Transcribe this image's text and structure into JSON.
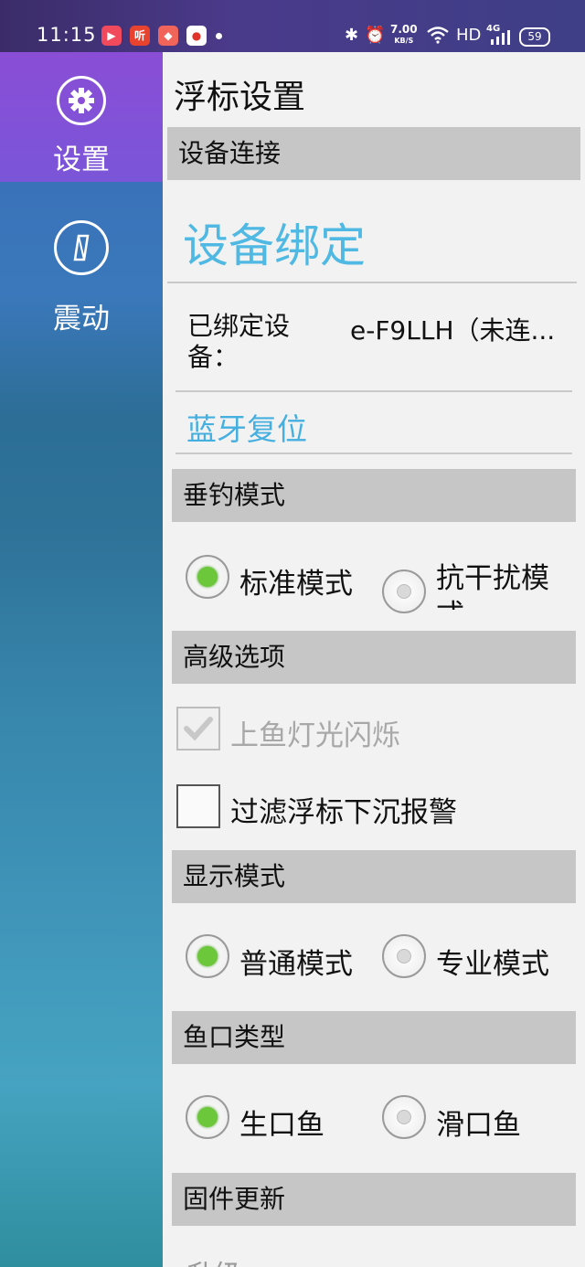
{
  "status_bar": {
    "time": "11:15",
    "net_speed": "7.00",
    "net_unit": "KB/S",
    "hd": "HD",
    "network": "4G",
    "battery": "59",
    "app_icons": [
      "video-app",
      "ting-app",
      "game-app",
      "red-app"
    ],
    "icons": [
      "bluetooth-icon",
      "alarm-icon",
      "wifi-icon",
      "signal-icon"
    ]
  },
  "sidebar": {
    "items": [
      {
        "label": "设置",
        "icon": "gear-icon",
        "active": true
      },
      {
        "label": "震动",
        "icon": "compass-icon",
        "active": false
      }
    ]
  },
  "main": {
    "title": "浮标设置",
    "device_section": {
      "header": "设备连接",
      "bind_title": "设备绑定",
      "bound_label_line1": "已绑定设",
      "bound_label_line2": "备：",
      "bound_value": "e-F9LLH（未连...",
      "bluetooth_reset": "蓝牙复位"
    },
    "fishing_mode": {
      "header": "垂钓模式",
      "options": [
        "标准模式",
        "抗干扰模式"
      ],
      "selected": "标准模式"
    },
    "advanced": {
      "header": "高级选项",
      "checkboxes": [
        {
          "label": "上鱼灯光闪烁",
          "checked": true,
          "disabled": true
        },
        {
          "label": "过滤浮标下沉报警",
          "checked": false,
          "disabled": false
        }
      ]
    },
    "display_mode": {
      "header": "显示模式",
      "options": [
        "普通模式",
        "专业模式"
      ],
      "selected": "普通模式"
    },
    "fish_type": {
      "header": "鱼口类型",
      "options": [
        "生口鱼",
        "滑口鱼"
      ],
      "selected": "生口鱼"
    },
    "firmware": {
      "header": "固件更新",
      "item": "升级"
    }
  },
  "colors": {
    "sidebar_active": "#8a4ed6",
    "accent_blue": "#4fb8e3",
    "radio_selected": "#6cc73b",
    "section_header": "#c6c6c6"
  }
}
